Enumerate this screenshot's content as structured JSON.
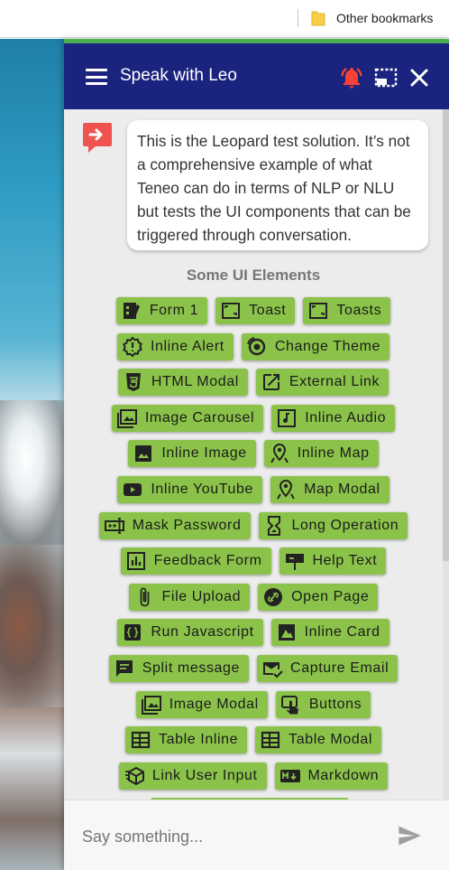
{
  "browser": {
    "bookmark_folder": "Other bookmarks"
  },
  "chat": {
    "title": "Speak with Leo",
    "colors": {
      "header": "#1a237e",
      "button": "#8bc34a",
      "bell": "#f44336",
      "accent_line": "#4caf50"
    },
    "bot_message": "This is the Leopard test solution. It’s not a comprehensive example of what Teneo can do in terms of NLP or NLU but tests the UI components that can be triggered through conversation.",
    "section_title": "Some UI Elements",
    "buttons": [
      {
        "label": "Form 1",
        "icon": "form-icon"
      },
      {
        "label": "Toast",
        "icon": "toast-icon"
      },
      {
        "label": "Toasts",
        "icon": "toast-icon"
      },
      {
        "label": "Inline Alert",
        "icon": "alert-icon"
      },
      {
        "label": "Change Theme",
        "icon": "theme-icon"
      },
      {
        "label": "HTML Modal",
        "icon": "html5-icon"
      },
      {
        "label": "External Link",
        "icon": "external-link-icon"
      },
      {
        "label": "Image Carousel",
        "icon": "image-carousel-icon"
      },
      {
        "label": "Inline Audio",
        "icon": "audio-icon"
      },
      {
        "label": "Inline Image",
        "icon": "image-icon"
      },
      {
        "label": "Inline Map",
        "icon": "map-icon"
      },
      {
        "label": "Inline YouTube",
        "icon": "youtube-icon"
      },
      {
        "label": "Map Modal",
        "icon": "map-icon"
      },
      {
        "label": "Mask Password",
        "icon": "password-icon"
      },
      {
        "label": "Long Operation",
        "icon": "hourglass-icon"
      },
      {
        "label": "Feedback Form",
        "icon": "chart-icon"
      },
      {
        "label": "Help Text",
        "icon": "sign-icon"
      },
      {
        "label": "File Upload",
        "icon": "paperclip-icon"
      },
      {
        "label": "Open Page",
        "icon": "link-icon"
      },
      {
        "label": "Run Javascript",
        "icon": "code-icon"
      },
      {
        "label": "Inline Card",
        "icon": "card-icon"
      },
      {
        "label": "Split message",
        "icon": "message-icon"
      },
      {
        "label": "Capture Email",
        "icon": "email-check-icon"
      },
      {
        "label": "Image Modal",
        "icon": "image-modal-icon"
      },
      {
        "label": "Buttons",
        "icon": "touch-icon"
      },
      {
        "label": "Table Inline",
        "icon": "table-icon"
      },
      {
        "label": "Table Modal",
        "icon": "table-icon"
      },
      {
        "label": "Link User Input",
        "icon": "link-input-icon"
      },
      {
        "label": "Markdown",
        "icon": "markdown-icon"
      }
    ],
    "input_placeholder": "Say something..."
  }
}
